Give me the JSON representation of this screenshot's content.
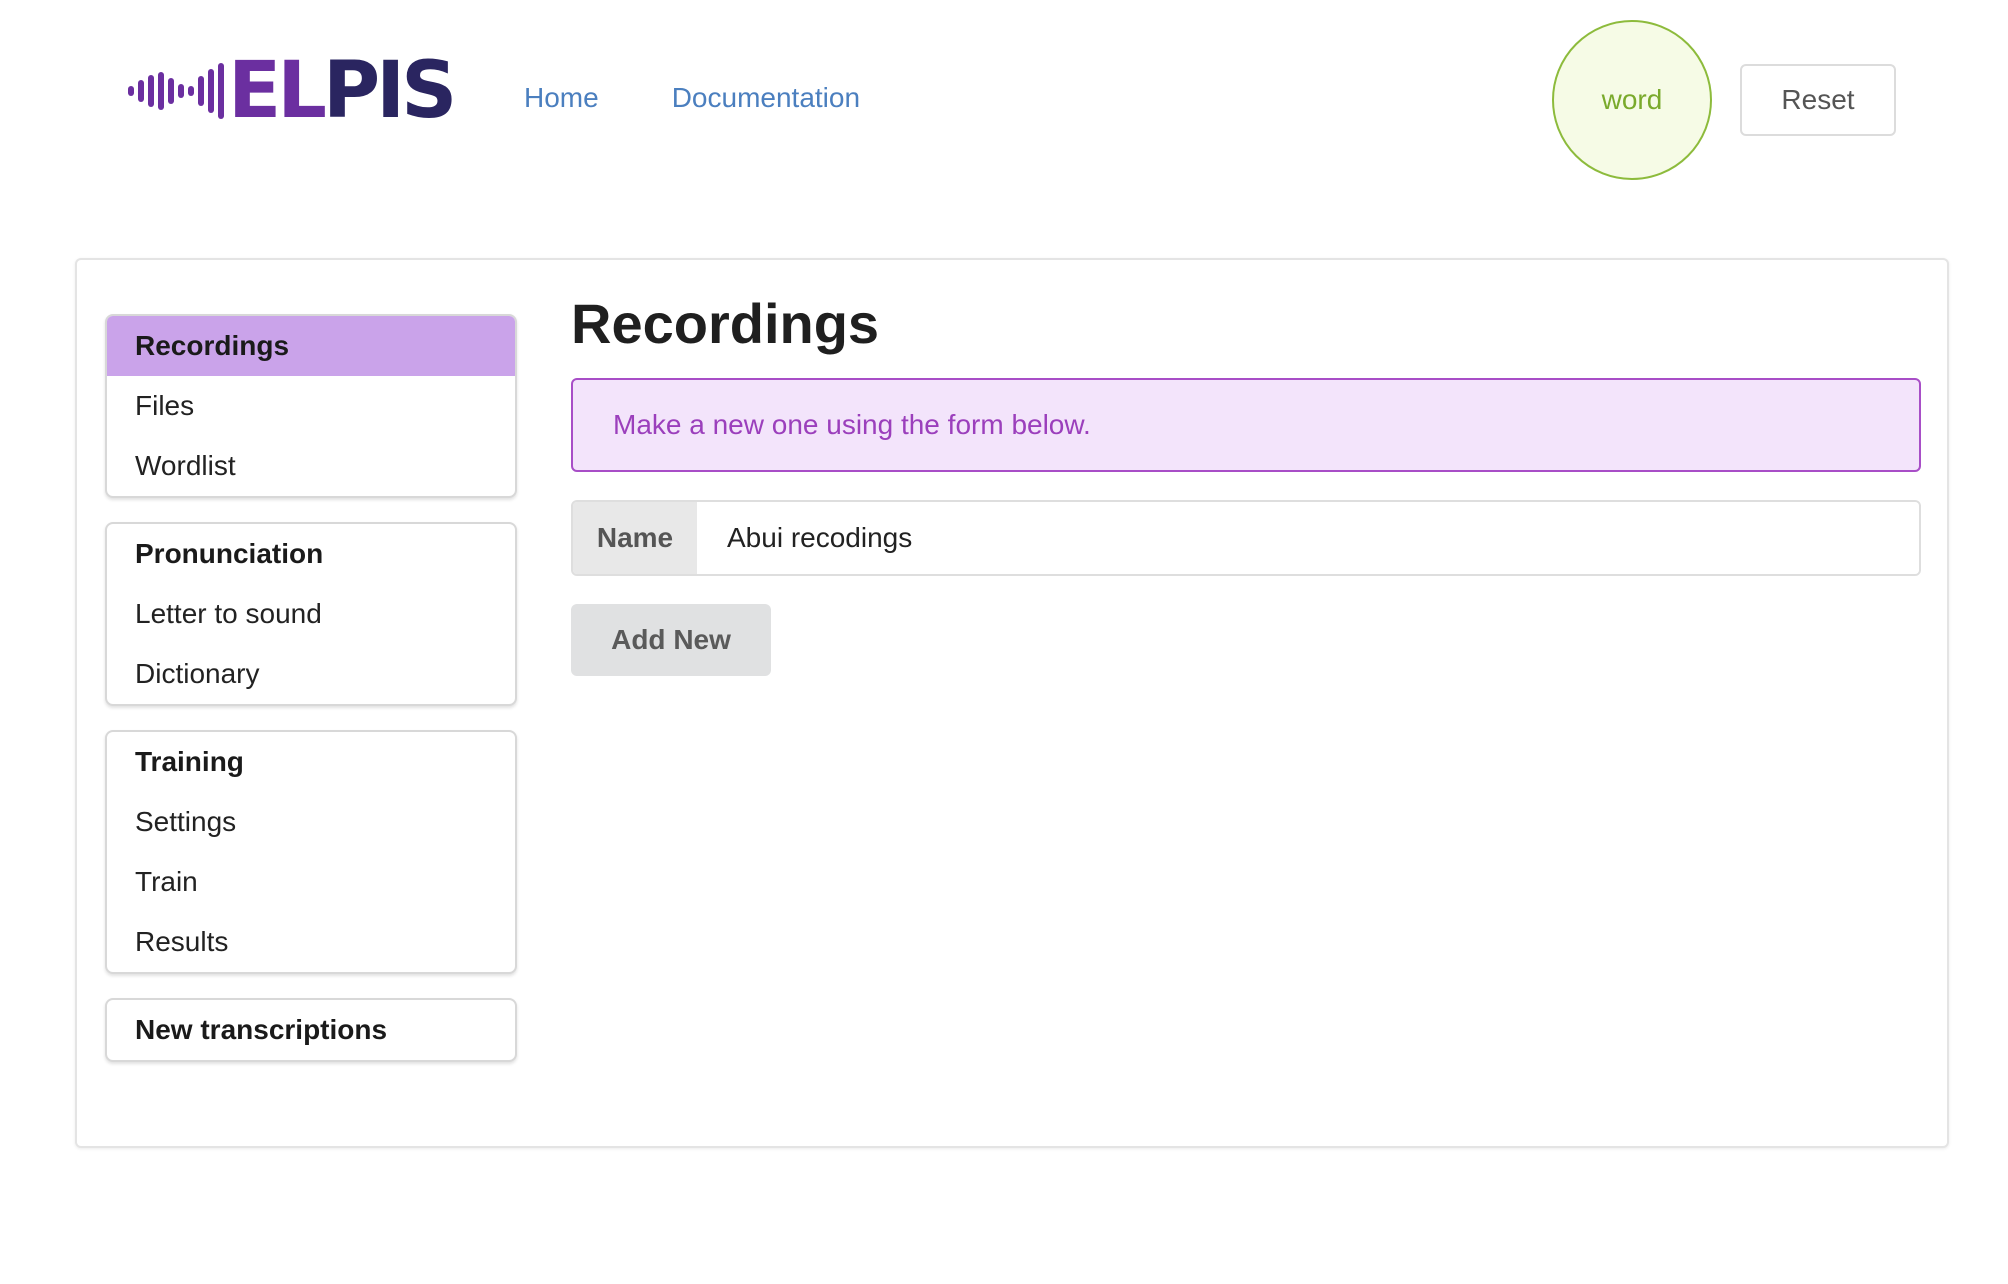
{
  "header": {
    "logo_text_part1": "EL",
    "logo_text_part2": "PIS",
    "nav": {
      "home": "Home",
      "documentation": "Documentation"
    },
    "word_badge": "word",
    "reset_label": "Reset"
  },
  "sidebar": {
    "groups": [
      {
        "items": [
          {
            "label": "Recordings",
            "type": "header",
            "active": true
          },
          {
            "label": "Files"
          },
          {
            "label": "Wordlist"
          }
        ]
      },
      {
        "items": [
          {
            "label": "Pronunciation",
            "type": "header"
          },
          {
            "label": "Letter to sound"
          },
          {
            "label": "Dictionary"
          }
        ]
      },
      {
        "items": [
          {
            "label": "Training",
            "type": "header"
          },
          {
            "label": "Settings"
          },
          {
            "label": "Train"
          },
          {
            "label": "Results"
          }
        ]
      },
      {
        "items": [
          {
            "label": "New transcriptions",
            "type": "header"
          }
        ]
      }
    ]
  },
  "main": {
    "title": "Recordings",
    "message": "Make a new one using the form below.",
    "name_label": "Name",
    "name_value": "Abui recodings",
    "add_button": "Add New"
  },
  "colors": {
    "accent": "#caa3ea",
    "message_bg": "#f3e4fb",
    "message_text": "#9b3fbc",
    "link": "#4b7fbf",
    "word_badge": "#8dbb3c"
  }
}
